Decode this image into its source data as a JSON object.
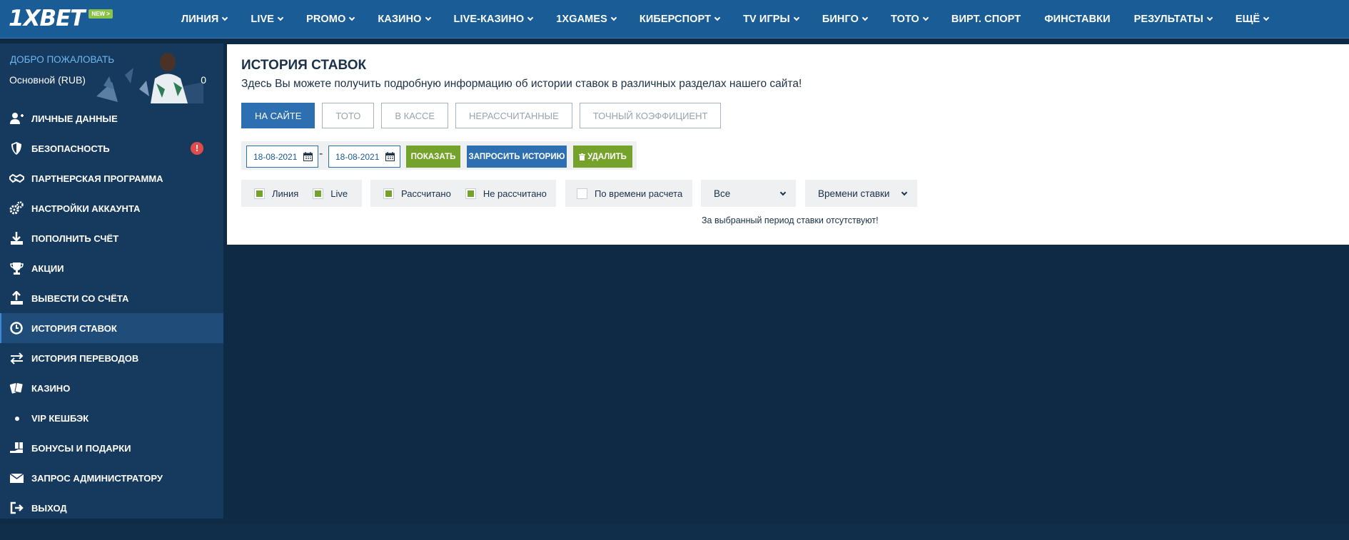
{
  "brand": {
    "logo_text": "1XBET",
    "new_badge": "NEW >"
  },
  "nav": [
    "ЛИНИЯ",
    "LIVE",
    "PROMO",
    "КАЗИНО",
    "LIVE-КАЗИНО",
    "1XGAMES",
    "КИБЕРСПОРТ",
    "TV ИГРЫ",
    "БИНГО",
    "ТОТО",
    "ВИРТ. СПОРТ",
    "ФИНСТАВКИ",
    "РЕЗУЛЬТАТЫ",
    "ЕЩЁ"
  ],
  "sidebar": {
    "welcome": "ДОБРО ПОЖАЛОВАТЬ",
    "account_name": "Основной (RUB)",
    "balance": "0",
    "items": [
      {
        "label": "ЛИЧНЫЕ ДАННЫЕ",
        "icon": "user-add-icon"
      },
      {
        "label": "БЕЗОПАСНОСТЬ",
        "icon": "shield-icon",
        "badge": "!"
      },
      {
        "label": "ПАРТНЕРСКАЯ ПРОГРАММА",
        "icon": "handshake-icon"
      },
      {
        "label": "НАСТРОЙКИ АККАУНТА",
        "icon": "gears-icon"
      },
      {
        "label": "ПОПОЛНИТЬ СЧЁТ",
        "icon": "download-icon"
      },
      {
        "label": "АКЦИИ",
        "icon": "trophy-icon"
      },
      {
        "label": "ВЫВЕСТИ СО СЧЁТА",
        "icon": "upload-icon"
      },
      {
        "label": "ИСТОРИЯ СТАВОК",
        "icon": "clock-icon",
        "active": true
      },
      {
        "label": "ИСТОРИЯ ПЕРЕВОДОВ",
        "icon": "transfer-icon"
      },
      {
        "label": "КАЗИНО",
        "icon": "cards-icon"
      },
      {
        "label": "VIP КЕШБЭК",
        "icon": "dot-icon"
      },
      {
        "label": "БОНУСЫ И ПОДАРКИ",
        "icon": "gift-hand-icon"
      },
      {
        "label": "ЗАПРОС АДМИНИСТРАТОРУ",
        "icon": "envelope-icon"
      },
      {
        "label": "ВЫХОД",
        "icon": "exit-icon"
      }
    ]
  },
  "main": {
    "title": "ИСТОРИЯ СТАВОК",
    "description": "Здесь Вы можете получить подробную информацию об истории ставок в различных разделах нашего сайта!",
    "tabs": [
      {
        "label": "НА САЙТЕ",
        "active": true
      },
      {
        "label": "ТОТО"
      },
      {
        "label": "В КАССЕ"
      },
      {
        "label": "НЕРАССЧИТАННЫЕ"
      },
      {
        "label": "ТОЧНЫЙ КОЭФФИЦИЕНТ"
      }
    ],
    "date_from": "18-08-2021",
    "date_to": "18-08-2021",
    "date_separator": "-",
    "show_button": "ПОКАЗАТЬ",
    "request_button": "ЗАПРОСИТЬ ИСТОРИЮ",
    "delete_button": "УДАЛИТЬ",
    "filters": {
      "line": {
        "label": "Линия",
        "checked": true
      },
      "live": {
        "label": "Live",
        "checked": true
      },
      "settled": {
        "label": "Рассчитано",
        "checked": true
      },
      "unsettled": {
        "label": "Не рассчитано",
        "checked": true
      },
      "by_settle_time": {
        "label": "По времени расчета",
        "checked": false
      }
    },
    "status_select": "Все",
    "sort_select": "Времени ставки",
    "empty_message": "За выбранный период ставки отсутствуют!"
  },
  "colors": {
    "header": "#1a5c95",
    "sidebar": "#163a5e",
    "background": "#0e2a45",
    "accent_green": "#75a22a",
    "accent_blue": "#2d6fb0"
  }
}
